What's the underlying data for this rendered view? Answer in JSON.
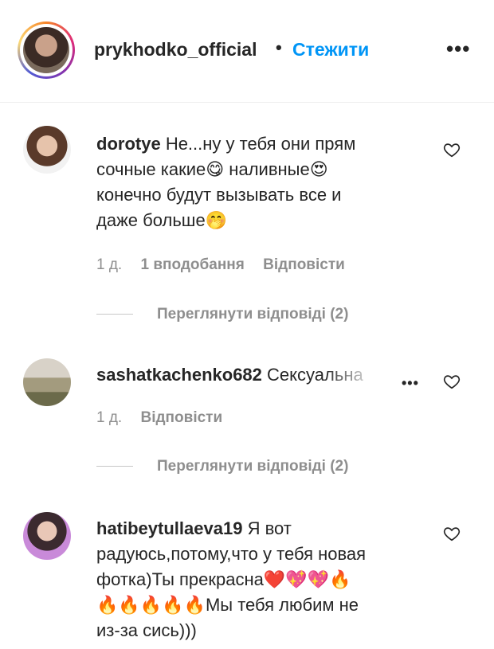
{
  "header": {
    "username": "prykhodko_official",
    "separator": "•",
    "follow_label": "Стежити",
    "more_label": "•••"
  },
  "comments": [
    {
      "username": "dorotye",
      "text_lines": [
        "Не...ну у тебя они прям",
        "сочные какие😋  наливные😍",
        "конечно будут вызывать все и",
        "даже больше🤭"
      ],
      "time": "1 д.",
      "likes": "1 вподобання",
      "reply_label": "Відповісти",
      "view_replies": "Переглянути відповіді (2)"
    },
    {
      "username": "sashatkachenko682",
      "text": "Сексуальна",
      "more_label": "•••",
      "time": "1 д.",
      "reply_label": "Відповісти",
      "view_replies": "Переглянути відповіді (2)"
    },
    {
      "username": "hatibeytullaeva19",
      "text_lines": [
        "Я вот",
        "радуюсь,потому,что у тебя новая",
        "фотка)Ты прекрасна❤️💖💖🔥",
        "🔥🔥🔥🔥🔥Мы тебя любим не",
        "из-за сись)))"
      ]
    }
  ],
  "colors": {
    "link": "#0095f6",
    "muted": "#8e8e8e",
    "text": "#262626"
  }
}
